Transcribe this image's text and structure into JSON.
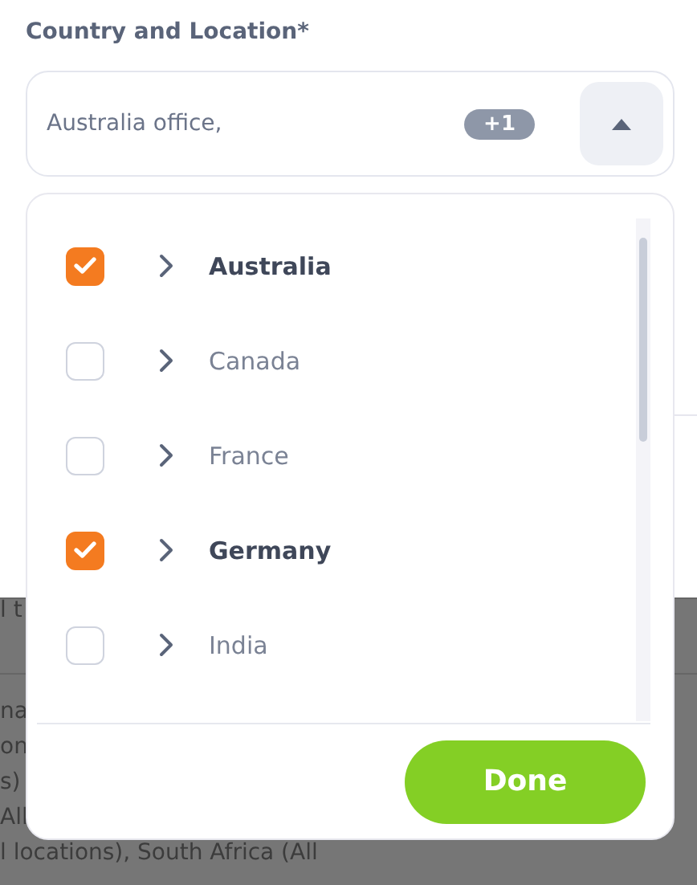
{
  "field": {
    "label": "Country and Location*",
    "value": "Australia office,",
    "count_badge": "+1",
    "expanded": true
  },
  "countries": [
    {
      "name": "Australia",
      "checked": true
    },
    {
      "name": "Canada",
      "checked": false
    },
    {
      "name": "France",
      "checked": false
    },
    {
      "name": "Germany",
      "checked": true
    },
    {
      "name": "India",
      "checked": false
    }
  ],
  "done_button": "Done",
  "background_text": [
    "l t",
    "na",
    "on",
    "s)",
    "All",
    "l locations), South Africa (All"
  ]
}
